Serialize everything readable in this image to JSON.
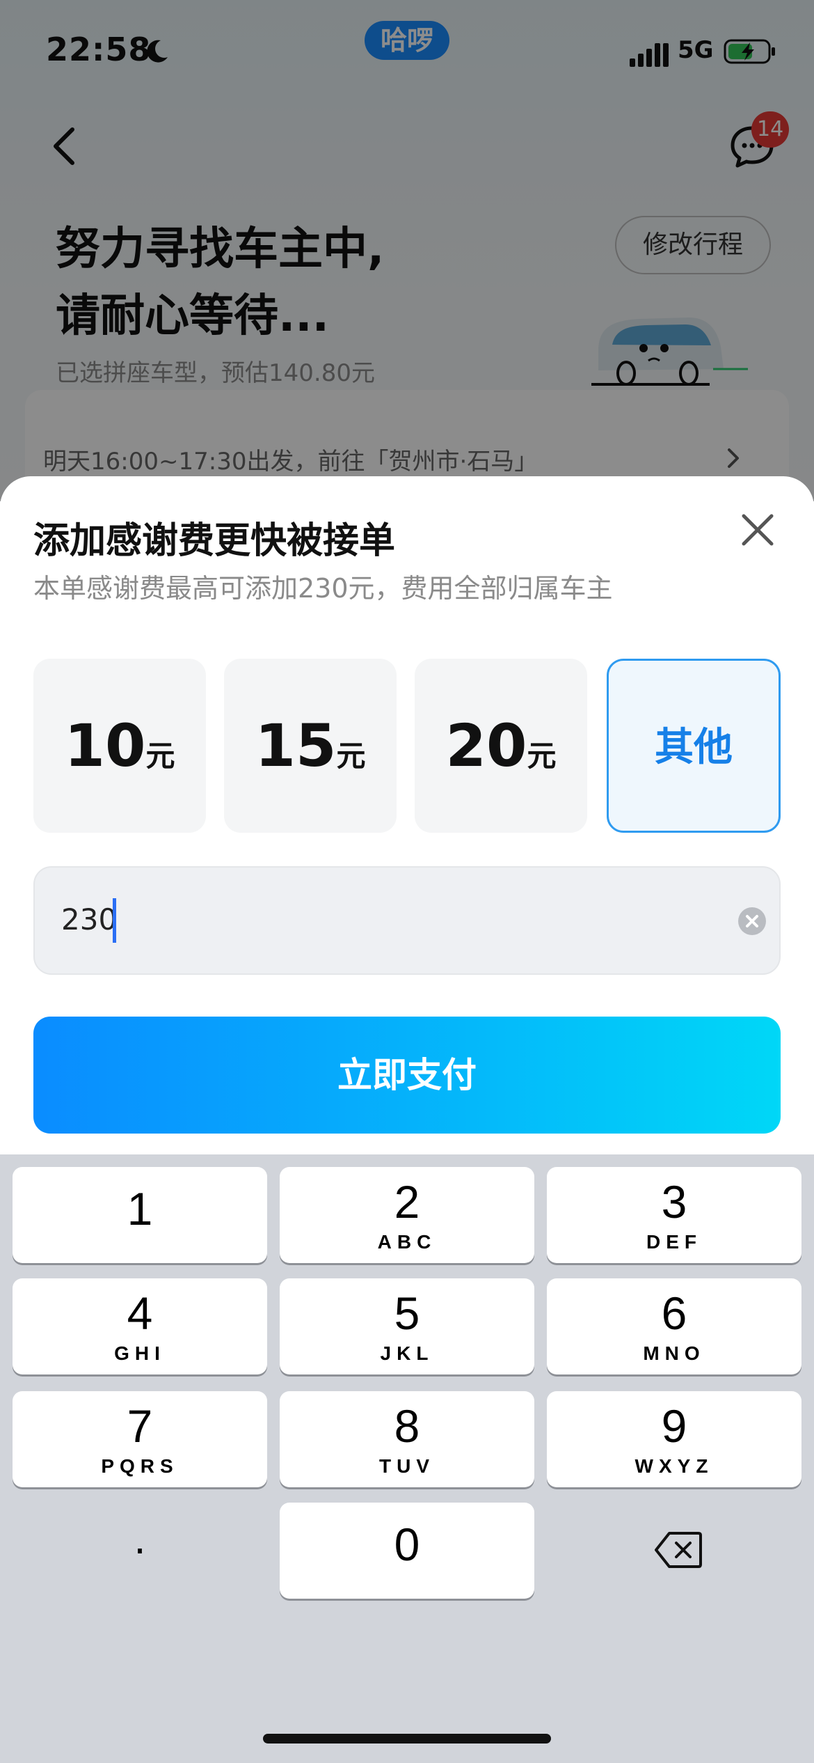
{
  "status_bar": {
    "time": "22:58",
    "carrier_app": "哈啰",
    "network": "5G",
    "icons": [
      "moon-icon",
      "signal-icon",
      "battery-charging-icon"
    ]
  },
  "nav": {
    "back_icon": "chevron-left-icon",
    "chat_icon": "chat-bubble-icon",
    "chat_badge": "14"
  },
  "status": {
    "title_line1": "努力寻找车主中,",
    "title_line2": "请耐心等待...",
    "modify_label": "修改行程",
    "fare_estimate": "已选拼座车型，预估140.80元",
    "trip_summary": "明天16:00~17:30出发，前往「贺州市·石马」"
  },
  "sheet": {
    "title": "添加感谢费更快被接单",
    "subtitle": "本单感谢费最高可添加230元，费用全部归属车主",
    "options": [
      {
        "amount": "10",
        "unit": "元"
      },
      {
        "amount": "15",
        "unit": "元"
      },
      {
        "amount": "20",
        "unit": "元"
      }
    ],
    "other_label": "其他",
    "selected": "其他",
    "input_value": "230",
    "pay_label": "立即支付"
  },
  "keyboard": {
    "keys": [
      {
        "digit": "1",
        "letters": ""
      },
      {
        "digit": "2",
        "letters": "ABC"
      },
      {
        "digit": "3",
        "letters": "DEF"
      },
      {
        "digit": "4",
        "letters": "GHI"
      },
      {
        "digit": "5",
        "letters": "JKL"
      },
      {
        "digit": "6",
        "letters": "MNO"
      },
      {
        "digit": "7",
        "letters": "PQRS"
      },
      {
        "digit": "8",
        "letters": "TUV"
      },
      {
        "digit": "9",
        "letters": "WXYZ"
      },
      {
        "digit": "0",
        "letters": ""
      }
    ],
    "dot_label": ".",
    "delete_icon": "backspace-icon"
  },
  "colors": {
    "accent": "#1680e8",
    "pay_gradient_start": "#0a8cff",
    "pay_gradient_end": "#00d7f7",
    "badge": "#e53935"
  }
}
